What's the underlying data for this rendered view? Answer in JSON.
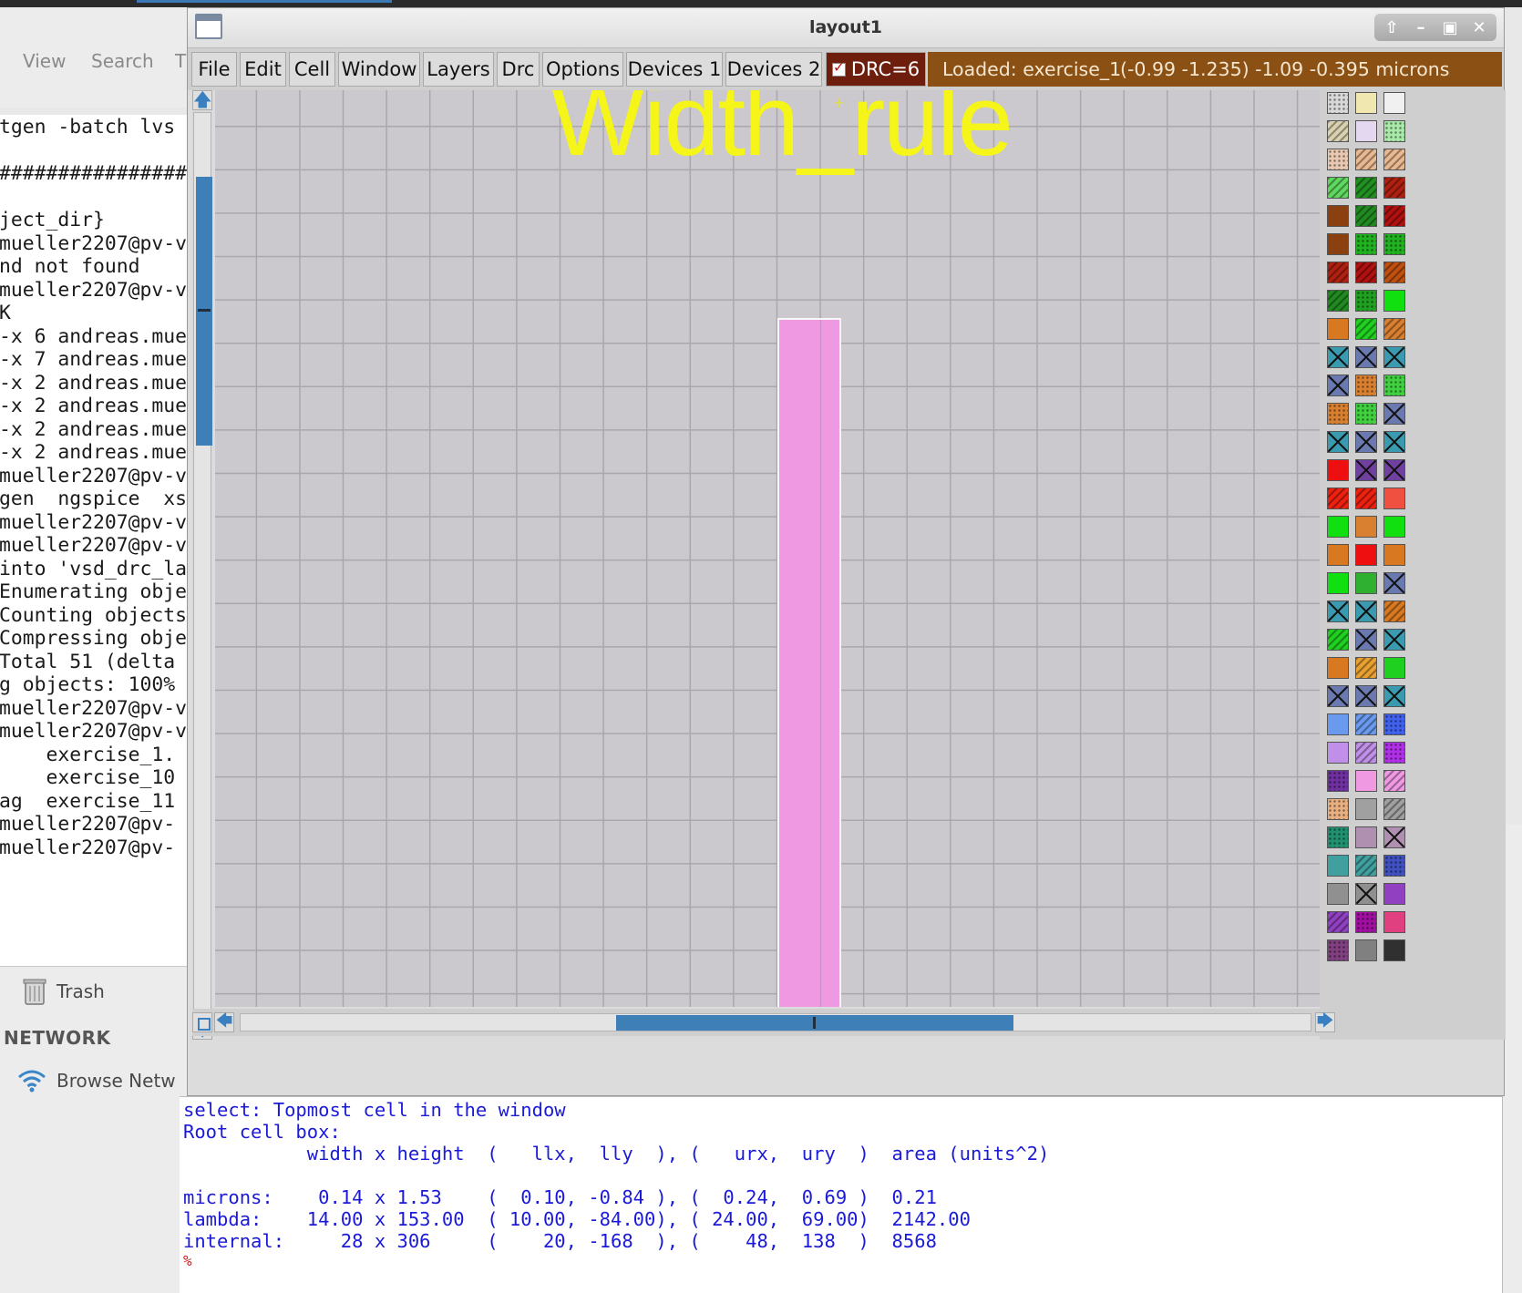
{
  "background": {
    "menu": [
      "View",
      "Search",
      "T"
    ],
    "terminal_lines": [
      "tgen -batch lvs",
      "",
      "################",
      "",
      "ject_dir}",
      "mueller2207@pv-v",
      "nd not found",
      "mueller2207@pv-v",
      "K",
      "-x 6 andreas.mue",
      "-x 7 andreas.mue",
      "-x 2 andreas.mue",
      "-x 2 andreas.mue",
      "-x 2 andreas.mue",
      "-x 2 andreas.mue",
      "mueller2207@pv-v",
      "gen  ngspice  xs",
      "mueller2207@pv-v",
      "mueller2207@pv-v",
      "into 'vsd_drc_la",
      "Enumerating obje",
      "Counting objects",
      "Compressing obje",
      "Total 51 (delta ",
      "g objects: 100% ",
      "mueller2207@pv-v",
      "mueller2207@pv-v",
      "    exercise_1.",
      "    exercise_10",
      "ag  exercise_11",
      "mueller2207@pv-",
      "mueller2207@pv-"
    ],
    "trash_label": "Trash",
    "network_heading": "NETWORK",
    "browse_label": "Browse Netw"
  },
  "window": {
    "title": "layout1",
    "menu": [
      "File",
      "Edit",
      "Cell",
      "Window",
      "Layers",
      "Drc",
      "Options",
      "Devices 1",
      "Devices 2"
    ],
    "drc_label": "DRC=6",
    "drc_checked": true,
    "status_loaded": "Loaded: exercise_1",
    "status_coords": "(-0.99 -1.235) -1.09 -0.395 microns"
  },
  "canvas": {
    "label": "Width_rule",
    "layer_color": "#ef99e3",
    "label_color": "#f5f51a"
  },
  "palette": {
    "rows": [
      [
        [
          "#d8d8d8",
          "d"
        ],
        [
          "#efe6b0",
          ""
        ],
        [
          "#f0f0f0",
          ""
        ]
      ],
      [
        [
          "#d8d2b0",
          "h"
        ],
        [
          "#e4d8f0",
          ""
        ],
        [
          "#a8e8a8",
          "d"
        ]
      ],
      [
        [
          "#e8c8b0",
          "d"
        ],
        [
          "#e8b890",
          "h"
        ],
        [
          "#e8b890",
          "h"
        ]
      ],
      [
        [
          "#60d860",
          "h"
        ],
        [
          "#209020",
          "h"
        ],
        [
          "#b02010",
          "h"
        ]
      ],
      [
        [
          "#8a4010",
          ""
        ],
        [
          "#208a20",
          "h"
        ],
        [
          "#b01010",
          "h"
        ]
      ],
      [
        [
          "#8a4010",
          ""
        ],
        [
          "#20b020",
          "d"
        ],
        [
          "#20b020",
          "d"
        ]
      ],
      [
        [
          "#b02010",
          "h"
        ],
        [
          "#b01010",
          "h"
        ],
        [
          "#c05010",
          "h"
        ]
      ],
      [
        [
          "#208a20",
          "h"
        ],
        [
          "#20a020",
          "d"
        ],
        [
          "#10e010",
          ""
        ]
      ],
      [
        [
          "#d87820",
          ""
        ],
        [
          "#20d020",
          "h"
        ],
        [
          "#d88030",
          "h"
        ]
      ],
      [
        [
          "#3a9ab0",
          "x"
        ],
        [
          "#6a7ab0",
          "x"
        ],
        [
          "#3a9ab0",
          "x"
        ]
      ],
      [
        [
          "#6a7ab0",
          "x"
        ],
        [
          "#d88030",
          "d"
        ],
        [
          "#40d040",
          "d"
        ]
      ],
      [
        [
          "#d88030",
          "d"
        ],
        [
          "#40d040",
          "d"
        ],
        [
          "#6a7ab0",
          "x"
        ]
      ],
      [
        [
          "#3a9ab0",
          "x"
        ],
        [
          "#6a7ab0",
          "x"
        ],
        [
          "#3a9ab0",
          "x"
        ]
      ],
      [
        [
          "#ee1010",
          ""
        ],
        [
          "#7040a0",
          "x"
        ],
        [
          "#7040a0",
          "x"
        ]
      ],
      [
        [
          "#ee2010",
          "h"
        ],
        [
          "#ee2010",
          "h"
        ],
        [
          "#f05040",
          ""
        ]
      ],
      [
        [
          "#10e010",
          ""
        ],
        [
          "#d88030",
          ""
        ],
        [
          "#10e010",
          ""
        ]
      ],
      [
        [
          "#d87820",
          ""
        ],
        [
          "#ee1010",
          ""
        ],
        [
          "#d87820",
          ""
        ]
      ],
      [
        [
          "#10e010",
          ""
        ],
        [
          "#30b030",
          ""
        ],
        [
          "#6a7ab0",
          "x"
        ]
      ],
      [
        [
          "#3a9ab0",
          "x"
        ],
        [
          "#3a9ab0",
          "x"
        ],
        [
          "#d87820",
          "h"
        ]
      ],
      [
        [
          "#20d020",
          "h"
        ],
        [
          "#6a7ab0",
          "x"
        ],
        [
          "#3a9ab0",
          "x"
        ]
      ],
      [
        [
          "#d87820",
          ""
        ],
        [
          "#e8a030",
          "h"
        ],
        [
          "#20d020",
          ""
        ]
      ],
      [
        [
          "#6a7ab0",
          "x"
        ],
        [
          "#6a7ab0",
          "x"
        ],
        [
          "#3a9ab0",
          "x"
        ]
      ],
      [
        [
          "#6a9aee",
          ""
        ],
        [
          "#6a9aee",
          "h"
        ],
        [
          "#4060ee",
          "d"
        ]
      ],
      [
        [
          "#c090e8",
          ""
        ],
        [
          "#c090e8",
          "h"
        ],
        [
          "#b030e8",
          "d"
        ]
      ],
      [
        [
          "#7030a0",
          "d"
        ],
        [
          "#ef99e3",
          ""
        ],
        [
          "#ef99e3",
          "h"
        ]
      ],
      [
        [
          "#e8b080",
          "d"
        ],
        [
          "#a0a0a0",
          ""
        ],
        [
          "#a0a0a0",
          "h"
        ]
      ],
      [
        [
          "#209070",
          "d"
        ],
        [
          "#b090b0",
          ""
        ],
        [
          "#b090b0",
          "x"
        ]
      ],
      [
        [
          "#40a0a0",
          ""
        ],
        [
          "#40a0a0",
          "h"
        ],
        [
          "#4050c0",
          "d"
        ]
      ],
      [
        [
          "#909090",
          ""
        ],
        [
          "#909090",
          "x"
        ],
        [
          "#9040c0",
          ""
        ]
      ],
      [
        [
          "#9040c0",
          "h"
        ],
        [
          "#a010a0",
          "d"
        ],
        [
          "#e04080",
          ""
        ]
      ],
      [
        [
          "#804080",
          "d"
        ],
        [
          "#808080",
          ""
        ],
        [
          "#303030",
          ""
        ]
      ]
    ]
  },
  "console": {
    "lines": [
      "select: Topmost cell in the window",
      "Root cell box:",
      "           width x height  (   llx,  lly  ), (   urx,  ury  )  area (units^2)",
      "",
      "microns:    0.14 x 1.53    (  0.10, -0.84 ), (  0.24,  0.69 )  0.21",
      "lambda:    14.00 x 153.00  ( 10.00, -84.00), ( 24.00,  69.00)  2142.00",
      "internal:     28 x 306     (    20, -168  ), (    48,  138  )  8568"
    ],
    "prompt": "%"
  }
}
